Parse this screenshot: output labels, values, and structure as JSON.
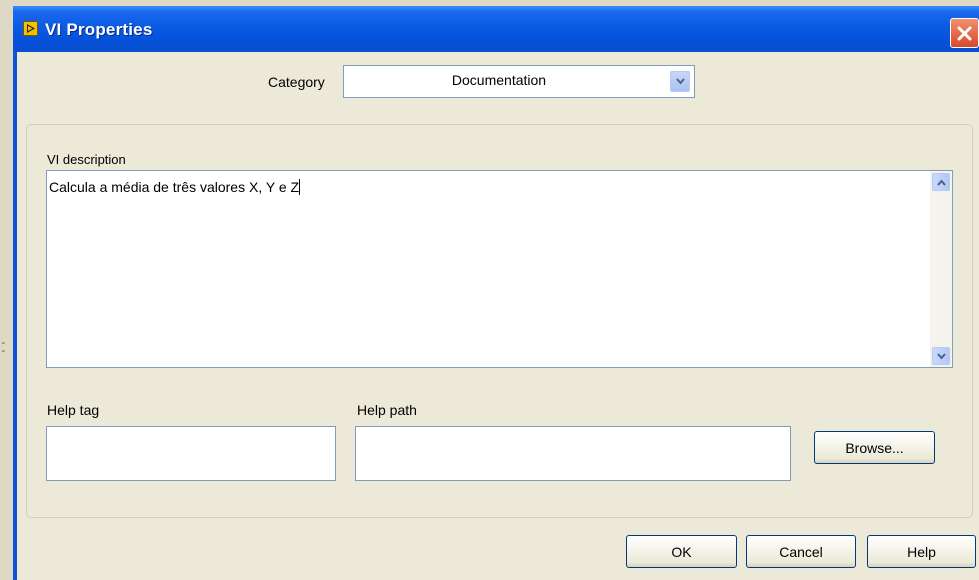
{
  "window": {
    "title": "VI Properties"
  },
  "category": {
    "label": "Category",
    "value": "Documentation"
  },
  "description": {
    "label": "VI description",
    "text": "Calcula a média de três valores X, Y e Z"
  },
  "help_tag": {
    "label": "Help tag",
    "value": ""
  },
  "help_path": {
    "label": "Help path",
    "value": ""
  },
  "buttons": {
    "browse": "Browse...",
    "ok": "OK",
    "cancel": "Cancel",
    "help": "Help"
  },
  "background": {
    "dash": "- -"
  }
}
